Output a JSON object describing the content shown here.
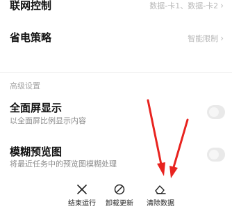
{
  "settings": {
    "network_control": {
      "title": "联网控制",
      "value": "数据-卡1、数据-卡2"
    },
    "battery_policy": {
      "title": "省电策略",
      "value": "智能限制"
    },
    "advanced_section_label": "高级设置",
    "fullscreen": {
      "title": "全面屏显示",
      "subtitle": "以全面屏比例显示内容",
      "enabled": false
    },
    "blur_preview": {
      "title": "模糊预览图",
      "subtitle": "将最近任务中的预览图模糊处理",
      "enabled": false
    }
  },
  "actions": {
    "force_stop": {
      "label": "结束运行",
      "icon": "close-icon"
    },
    "uninstall_updates": {
      "label": "卸载更新",
      "icon": "prohibit-icon"
    },
    "clear_data": {
      "label": "清除数据",
      "icon": "eraser-icon"
    }
  },
  "colors": {
    "annotation_arrow": "#e8231f",
    "toggle_off": "#e9e9e9"
  }
}
